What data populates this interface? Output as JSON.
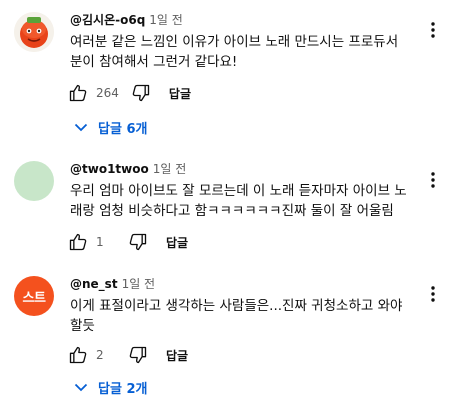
{
  "comments": [
    {
      "author": "@김시온-o6q",
      "time": "1일 전",
      "text_line1": "여러분 같은 느낌인 이유가 아이브 노래 만드시는 프로듀서",
      "text_line2": "분이 참여해서 그런거 같다요!",
      "likes": "264",
      "reply_label": "답글",
      "replies_label": "답글 6개",
      "avatar_bg": "#e84a1c"
    },
    {
      "author": "@two1twoo",
      "time": "1일 전",
      "text_line1": "우리 엄마 아이브도 잘 모르는데 이 노래 듣자마자 아이브 노",
      "text_line2": "래랑 엄청 비슷하다고 함ㅋㅋㅋㅋㅋㅋ진짜 둘이 잘 어울림",
      "likes": "1",
      "reply_label": "답글",
      "avatar_bg": "#c8e6c9"
    },
    {
      "author": "@ne_st",
      "time": "1일 전",
      "text_line1": "이게 표절이라고 생각하는 사람들은...진짜 귀청소하고 와야",
      "text_line2": "할듯",
      "likes": "2",
      "reply_label": "답글",
      "replies_label": "답글 2개",
      "avatar_text": "스트",
      "avatar_bg": "#f4511e"
    }
  ],
  "colors": {
    "link_blue": "#065fd4",
    "muted": "#606060",
    "text": "#0f0f0f"
  },
  "icons": [
    "thumb-up-icon",
    "thumb-down-icon",
    "more-vert-icon",
    "chevron-down-icon"
  ]
}
